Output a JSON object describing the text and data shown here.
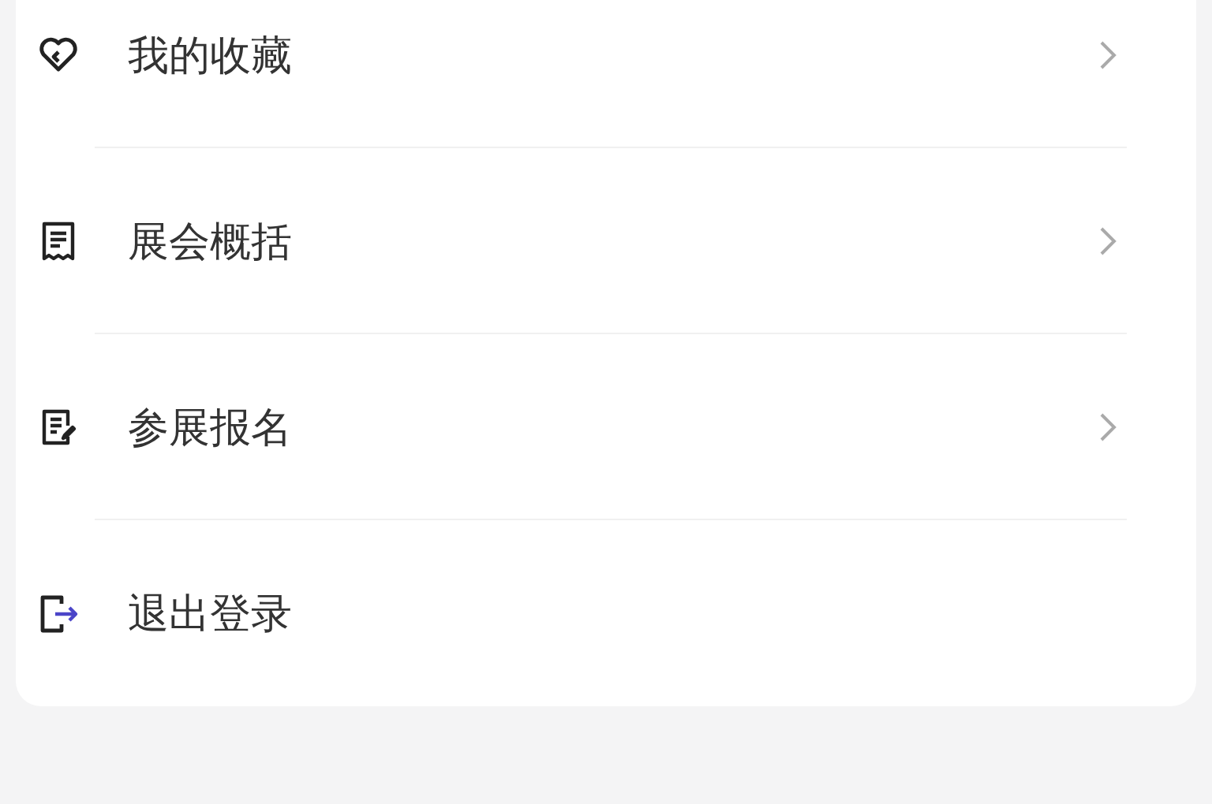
{
  "menu": {
    "items": [
      {
        "label": "我的收藏",
        "kind": "nav"
      },
      {
        "label": "展会概括",
        "kind": "nav"
      },
      {
        "label": "参展报名",
        "kind": "nav"
      },
      {
        "label": "退出登录",
        "kind": "action"
      }
    ]
  }
}
